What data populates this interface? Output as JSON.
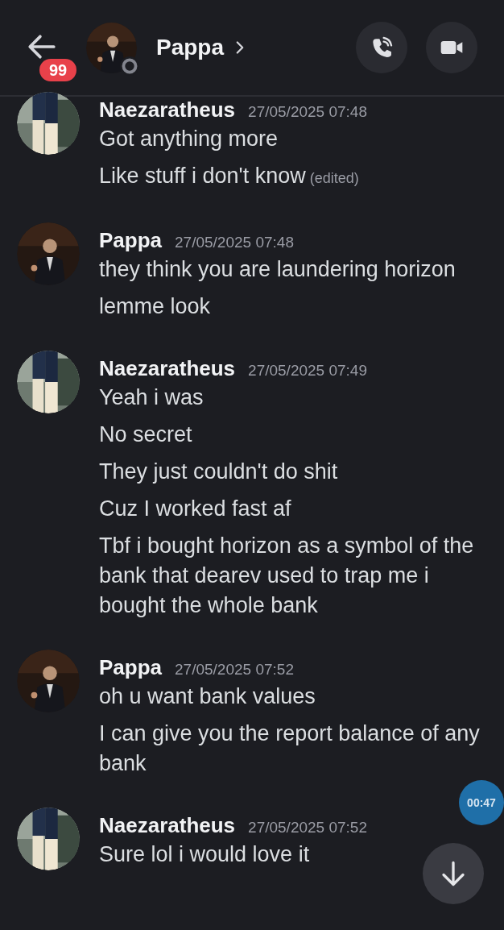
{
  "header": {
    "badge": "99",
    "title": "Pappa"
  },
  "messages": [
    {
      "author": "Naezaratheus",
      "timestamp": "27/05/2025 07:48",
      "lines": [
        {
          "text": "Got anything more"
        },
        {
          "text": "Like stuff i don't know",
          "edited": "(edited)"
        }
      ]
    },
    {
      "author": "Pappa",
      "timestamp": "27/05/2025 07:48",
      "lines": [
        {
          "text": "they think you are laundering horizon"
        },
        {
          "text": "lemme look"
        }
      ]
    },
    {
      "author": "Naezaratheus",
      "timestamp": "27/05/2025 07:49",
      "lines": [
        {
          "text": "Yeah i was"
        },
        {
          "text": "No secret"
        },
        {
          "text": "They just couldn't do shit"
        },
        {
          "text": "Cuz I worked fast af"
        },
        {
          "text": "Tbf i bought horizon as a symbol of the bank that dearev used to trap me i bought the whole bank"
        }
      ]
    },
    {
      "author": "Pappa",
      "timestamp": "27/05/2025 07:52",
      "lines": [
        {
          "text": "oh u want bank values"
        },
        {
          "text": "I can give you the report balance of any bank"
        }
      ]
    },
    {
      "author": "Naezaratheus",
      "timestamp": "27/05/2025 07:52",
      "lines": [
        {
          "text": "Sure lol i would love it"
        }
      ]
    }
  ],
  "timer": "00:47"
}
